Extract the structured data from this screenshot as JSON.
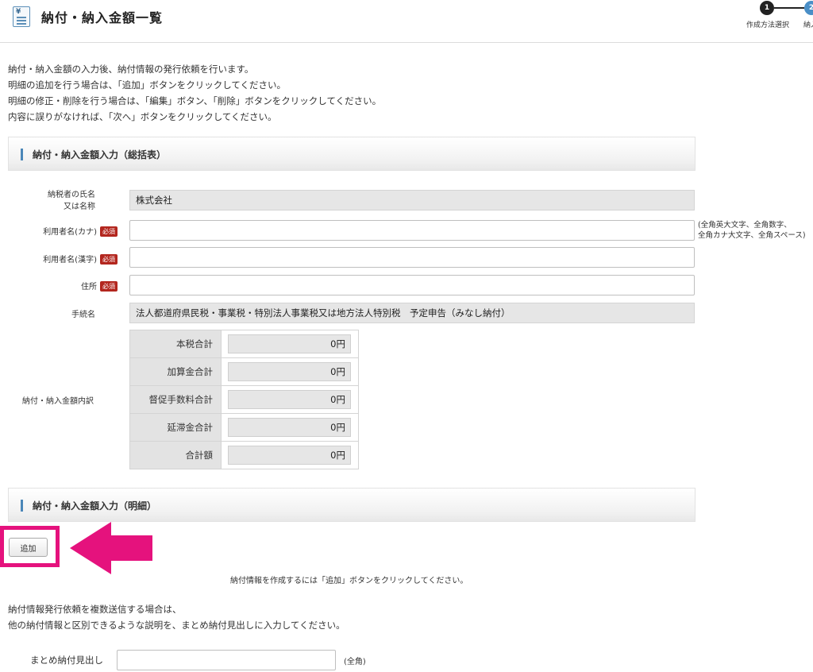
{
  "header": {
    "title": "納付・納入金額一覧",
    "steps": [
      {
        "number": "1",
        "label": "作成方法選択"
      },
      {
        "number": "2",
        "label": "納入金"
      }
    ]
  },
  "intro": {
    "lines": [
      "納付・納入金額の入力後、納付情報の発行依頼を行います。",
      "明細の追加を行う場合は、「追加」ボタンをクリックしてください。",
      "明細の修正・削除を行う場合は、「編集」ボタン、「削除」ボタンをクリックしてください。",
      "内容に誤りがなければ、「次へ」ボタンをクリックしてください。"
    ]
  },
  "summary_section": {
    "title": "納付・納入金額入力（総括表）"
  },
  "form": {
    "required_badge": "必須",
    "taxpayer": {
      "label_line1": "納税者の氏名",
      "label_line2": "又は名称",
      "value": "株式会社"
    },
    "user_kana": {
      "label": "利用者名(カナ)",
      "value": ""
    },
    "user_kanji": {
      "label": "利用者名(漢字)",
      "value": ""
    },
    "address": {
      "label": "住所",
      "value": ""
    },
    "procedure": {
      "label": "手続名",
      "value": "法人都道府県民税・事業税・特別法人事業税又は地方法人特別税　予定申告（みなし納付）"
    },
    "kana_note_line1": "(全角英大文字、全角数字、",
    "kana_note_line2": "全角カナ大文字、全角スペース)"
  },
  "amounts": {
    "label": "納付・納入金額内訳",
    "rows": [
      {
        "name": "本税合計",
        "value": "0円"
      },
      {
        "name": "加算金合計",
        "value": "0円"
      },
      {
        "name": "督促手数料合計",
        "value": "0円"
      },
      {
        "name": "延滞金合計",
        "value": "0円"
      },
      {
        "name": "合計額",
        "value": "0円"
      }
    ]
  },
  "detail_section": {
    "title": "納付・納入金額入力（明細）"
  },
  "add_button": {
    "label": "追加"
  },
  "add_hint": "納付情報を作成するには「追加」ボタンをクリックしてください。",
  "multi_send": {
    "line1": "納付情報発行依頼を複数送信する場合は、",
    "line2": "他の納付情報と区別できるような説明を、まとめ納付見出しに入力してください。"
  },
  "matome": {
    "label": "まとめ納付見出し",
    "value": "",
    "note": "(全角)"
  },
  "colors": {
    "highlight": "#e5127d",
    "required": "#b3261e",
    "accent": "#4a86b8"
  }
}
